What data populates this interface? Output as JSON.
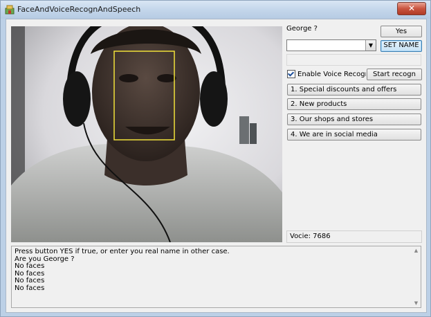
{
  "window": {
    "title": "FaceAndVoiceRecognAndSpeech",
    "close_glyph": "✕"
  },
  "recognition": {
    "guess_label": "George ?",
    "yes_label": "Yes",
    "set_name_label": "SET NAME",
    "name_combo_value": "",
    "combo_arrow_glyph": "▼"
  },
  "voice": {
    "enable_label": "Enable Voice Recognitio",
    "enable_checked": true,
    "start_label": "Start recogn",
    "status": "Vocie: 7686"
  },
  "menu": {
    "items": [
      "1. Special discounts and offers",
      "2. New products",
      "3. Our shops and stores",
      "4. We are in social media"
    ]
  },
  "log": {
    "text": "Press button YES if true, or enter you real name in other case.\nAre you George ?\nNo faces\nNo faces\nNo faces\nNo faces",
    "scroll_up_glyph": "▲",
    "scroll_down_glyph": "▼"
  },
  "colors": {
    "face_box": "#f2e23a",
    "title_bar": "#c2d5ea",
    "close_button": "#c9543f"
  },
  "icons": {
    "app": "app-icon",
    "close": "close-icon",
    "combo": "chevron-down-icon"
  }
}
